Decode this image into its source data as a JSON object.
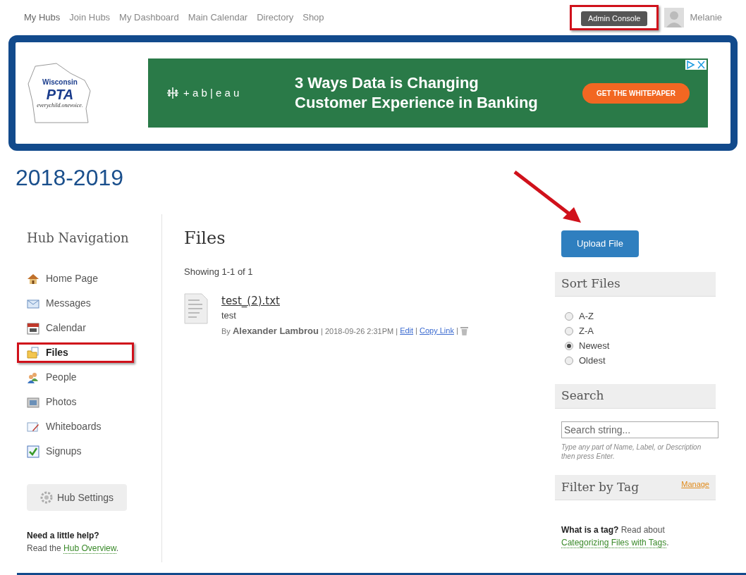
{
  "top_nav": {
    "links": [
      "My Hubs",
      "Join Hubs",
      "My Dashboard",
      "Main Calendar",
      "Directory",
      "Shop"
    ],
    "admin_button": "Admin Console",
    "user_name": "Melanie"
  },
  "banner": {
    "logo": {
      "state": "Wisconsin",
      "name": "PTA",
      "tagline": "everychild.onevoice."
    },
    "ad": {
      "brand": "+ a b | e a u",
      "headline": [
        "3 Ways Data is Changing",
        "Customer Experience in Banking"
      ],
      "cta": "GET THE WHITEPAPER"
    }
  },
  "page_title": "2018-2019",
  "sidebar": {
    "title": "Hub Navigation",
    "items": [
      {
        "label": "Home Page",
        "selected": false
      },
      {
        "label": "Messages",
        "selected": false
      },
      {
        "label": "Calendar",
        "selected": false
      },
      {
        "label": "Files",
        "selected": true
      },
      {
        "label": "People",
        "selected": false
      },
      {
        "label": "Photos",
        "selected": false
      },
      {
        "label": "Whiteboards",
        "selected": false
      },
      {
        "label": "Signups",
        "selected": false
      }
    ],
    "settings_button": "Hub Settings",
    "help": {
      "title": "Need a little help?",
      "text": "Read the ",
      "link": "Hub Overview",
      "end": "."
    }
  },
  "main": {
    "title": "Files",
    "count": "Showing 1-1 of 1",
    "files": [
      {
        "name": "test_(2).txt",
        "description": "test",
        "by": "By",
        "author": "Alexander Lambrou",
        "date": "2018-09-26 2:31PM",
        "separator": "|",
        "actions": [
          "Edit",
          "Copy Link"
        ]
      }
    ]
  },
  "right": {
    "upload_button": "Upload File",
    "sort": {
      "title": "Sort Files",
      "options": [
        {
          "label": "A-Z",
          "selected": false
        },
        {
          "label": "Z-A",
          "selected": false
        },
        {
          "label": "Newest",
          "selected": true
        },
        {
          "label": "Oldest",
          "selected": false
        }
      ]
    },
    "search": {
      "title": "Search",
      "placeholder": "Search string...",
      "hint": "Type any part of Name, Label, or Description then press Enter."
    },
    "tags": {
      "title": "Filter by Tag",
      "manage": "Manage",
      "question": "What is a tag?",
      "text": " Read about ",
      "link": "Categorizing Files with Tags",
      "end": "."
    }
  }
}
